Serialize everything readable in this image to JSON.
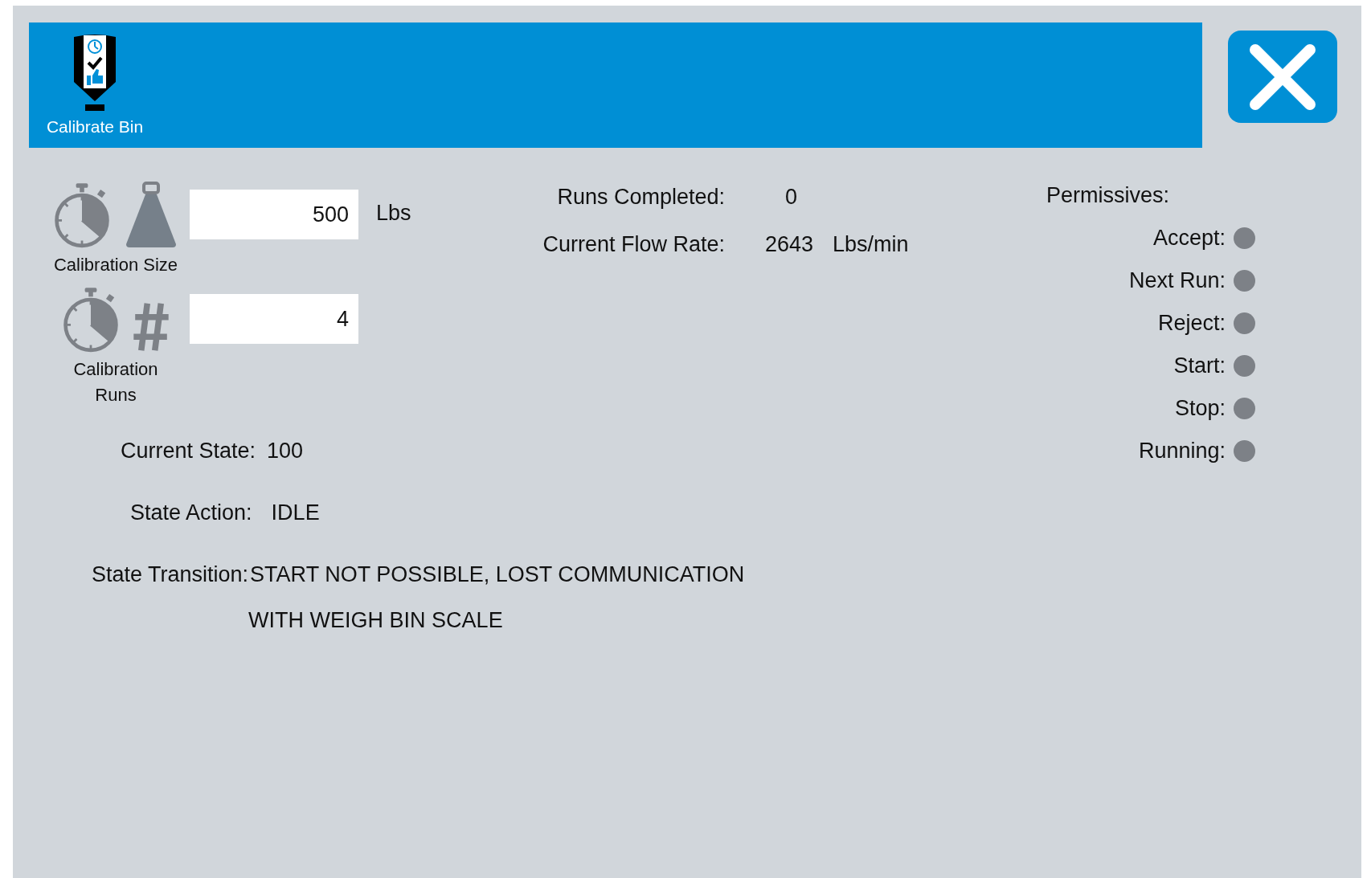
{
  "header": {
    "title": "Calibrate Bin"
  },
  "calibration": [
    {
      "kind": "size",
      "label": "Calibration Size",
      "value": "500",
      "unit": "Lbs"
    },
    {
      "kind": "runs",
      "label": "Calibration\nRuns",
      "value": "4"
    }
  ],
  "runs_completed": {
    "label": "Runs Completed:",
    "value": "0"
  },
  "flow_rate": {
    "label": "Current Flow Rate:",
    "value": "2643",
    "unit": "Lbs/min"
  },
  "permissives": {
    "title": "Permissives:",
    "items": [
      {
        "label": "Accept:",
        "on": false
      },
      {
        "label": "Next Run:",
        "on": false
      },
      {
        "label": "Reject:",
        "on": false
      },
      {
        "label": "Start:",
        "on": false
      },
      {
        "label": "Stop:",
        "on": false
      },
      {
        "label": "Running:",
        "on": false
      }
    ]
  },
  "current_state": {
    "label": "Current State:",
    "value": "100"
  },
  "state_action": {
    "label": "State Action:",
    "value": "IDLE"
  },
  "state_transition": {
    "label": "State Transition:",
    "lines": [
      "START NOT POSSIBLE, LOST COMMUNICATION",
      "WITH WEIGH BIN SCALE"
    ]
  }
}
